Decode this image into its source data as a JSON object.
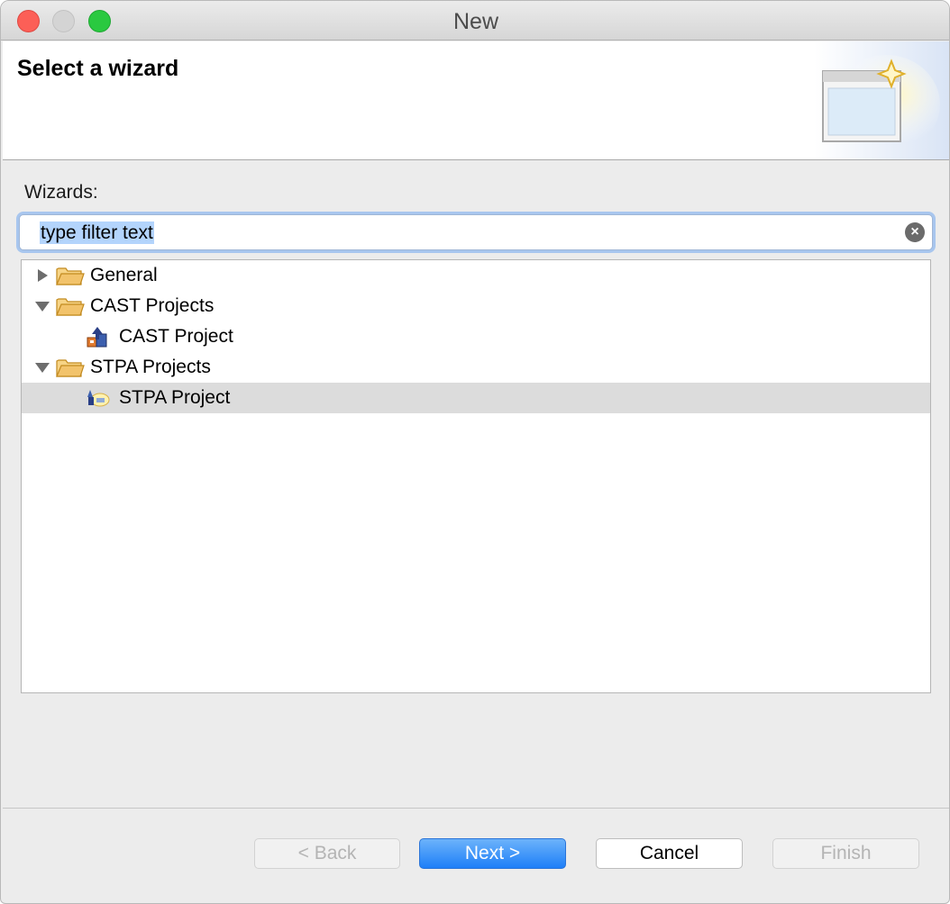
{
  "window": {
    "title": "New"
  },
  "header": {
    "title": "Select a wizard"
  },
  "wizards": {
    "label": "Wizards:",
    "filter_value": "type filter text"
  },
  "tree": {
    "items": [
      {
        "label": "General",
        "expanded": false,
        "kind": "folder",
        "icon": "folder-icon"
      },
      {
        "label": "CAST Projects",
        "expanded": true,
        "kind": "folder",
        "icon": "folder-icon"
      },
      {
        "label": "CAST Project",
        "kind": "wizard",
        "icon": "cast-project-icon"
      },
      {
        "label": "STPA Projects",
        "expanded": true,
        "kind": "folder",
        "icon": "folder-icon"
      },
      {
        "label": "STPA Project",
        "kind": "wizard",
        "icon": "stpa-project-icon",
        "selected": true
      }
    ]
  },
  "buttons": {
    "back": "< Back",
    "next": "Next >",
    "cancel": "Cancel",
    "finish": "Finish"
  },
  "colors": {
    "accent": "#1e7ff8",
    "selection": "#dcdcdc",
    "folder": "#f2c36b"
  }
}
